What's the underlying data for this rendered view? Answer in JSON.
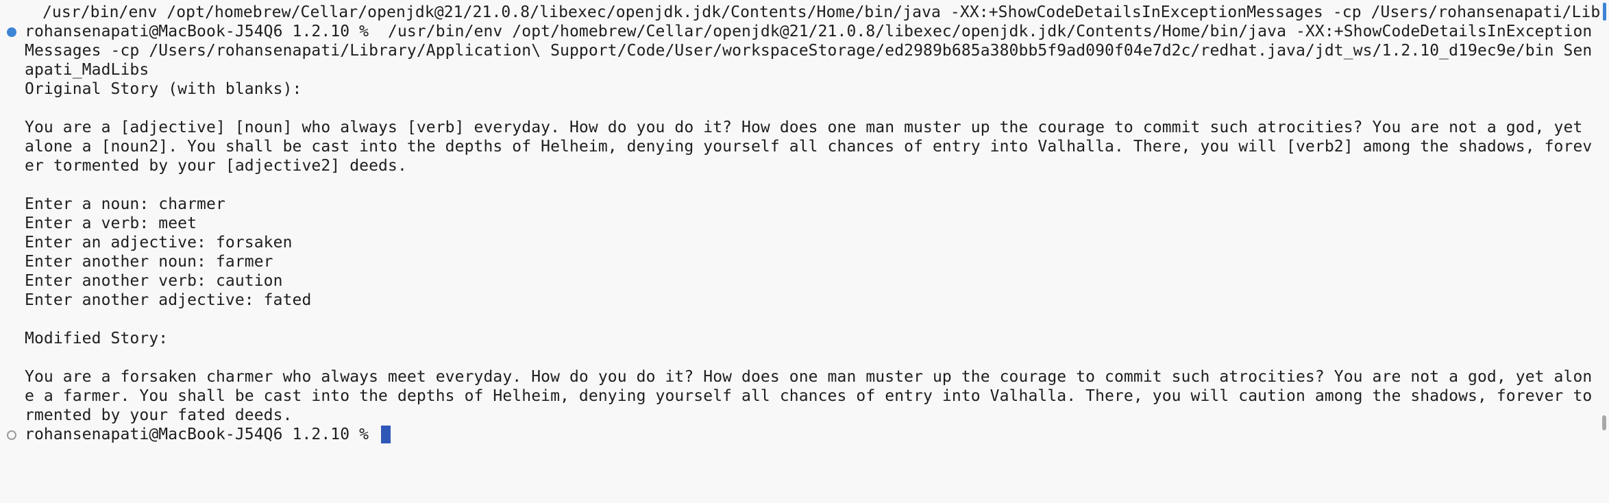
{
  "terminal": {
    "command_partial": " /usr/bin/env /opt/homebrew/Cellar/openjdk@21/21.0.8/libexec/openjdk.jdk/Contents/Home/bin/java -XX:+ShowCodeDetailsInExceptionMessages -cp /Users/rohansenapati/Lib",
    "prompt_line_1": "rohansenapati@MacBook-J54Q6 1.2.10 %  /usr/bin/env /opt/homebrew/Cellar/openjdk@21/21.0.8/libexec/openjdk.jdk/Contents/Home/bin/java -XX:+ShowCodeDetailsInException",
    "prompt_line_2": "Messages -cp /Users/rohansenapati/Library/Application\\ Support/Code/User/workspaceStorage/ed2989b685a380bb5f9ad090f04e7d2c/redhat.java/jdt_ws/1.2.10_d19ec9e/bin Sen",
    "prompt_line_3": "apati_MadLibs",
    "original_heading": "Original Story (with blanks):",
    "original_story": [
      "You are a [adjective] [noun] who always [verb] everyday. How do you do it? How does one man muster up the courage to commit such atrocities? You are not a god, yet",
      "alone a [noun2]. You shall be cast into the depths of Helheim, denying yourself all chances of entry into Valhalla. There, you will [verb2] among the shadows, forev",
      "er tormented by your [adjective2] deeds."
    ],
    "inputs": [
      "Enter a noun: charmer",
      "Enter a verb: meet",
      "Enter an adjective: forsaken",
      "Enter another noun: farmer",
      "Enter another verb: caution",
      "Enter another adjective: fated"
    ],
    "modified_heading": "Modified Story:",
    "modified_story": [
      "You are a forsaken charmer who always meet everyday. How do you do it? How does one man muster up the courage to commit such atrocities? You are not a god, yet alon",
      "e a farmer. You shall be cast into the depths of Helheim, denying yourself all chances of entry into Valhalla. There, you will caution among the shadows, forever to",
      "rmented by your fated deeds."
    ],
    "final_prompt": "rohansenapati@MacBook-J54Q6 1.2.10 % "
  },
  "colors": {
    "background": "#f8f8f8",
    "text": "#1e1e1e",
    "accent": "#3d84d4",
    "cursor": "#2f57b8"
  }
}
